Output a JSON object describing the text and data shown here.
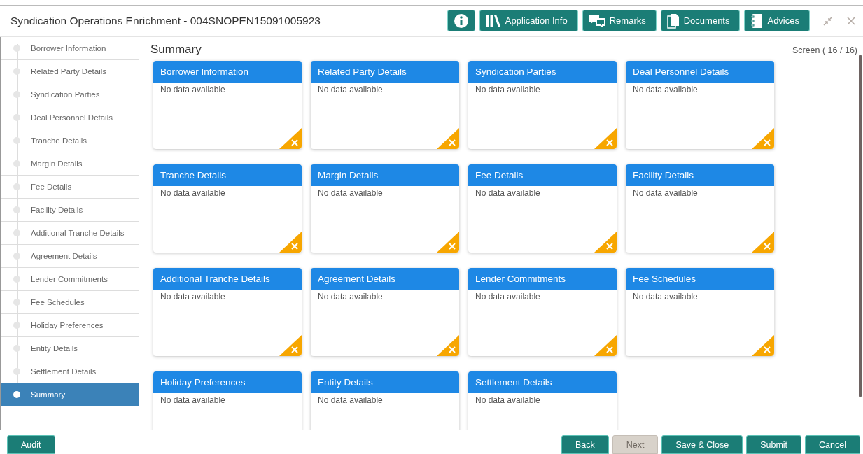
{
  "window": {
    "title": "Syndication Operations Enrichment - 004SNOPEN15091005923"
  },
  "header_buttons": [
    {
      "kind": "info"
    },
    {
      "kind": "books",
      "label": "Application Info"
    },
    {
      "kind": "chat",
      "label": "Remarks"
    },
    {
      "kind": "docs",
      "label": "Documents"
    },
    {
      "kind": "notebook",
      "label": "Advices"
    }
  ],
  "sidebar": {
    "items": [
      {
        "label": "Borrower Information",
        "selected": false
      },
      {
        "label": "Related Party Details",
        "selected": false
      },
      {
        "label": "Syndication Parties",
        "selected": false
      },
      {
        "label": "Deal Personnel Details",
        "selected": false
      },
      {
        "label": "Tranche Details",
        "selected": false
      },
      {
        "label": "Margin Details",
        "selected": false
      },
      {
        "label": "Fee Details",
        "selected": false
      },
      {
        "label": "Facility Details",
        "selected": false
      },
      {
        "label": "Additional Tranche Details",
        "selected": false
      },
      {
        "label": "Agreement Details",
        "selected": false
      },
      {
        "label": "Lender Commitments",
        "selected": false
      },
      {
        "label": "Fee Schedules",
        "selected": false
      },
      {
        "label": "Holiday Preferences",
        "selected": false
      },
      {
        "label": "Entity Details",
        "selected": false
      },
      {
        "label": "Settlement Details",
        "selected": false
      },
      {
        "label": "Summary",
        "selected": true
      }
    ]
  },
  "main": {
    "title": "Summary",
    "screen_counter": "Screen ( 16 / 16)",
    "cards": [
      {
        "title": "Borrower Information",
        "body": "No data available"
      },
      {
        "title": "Related Party Details",
        "body": "No data available"
      },
      {
        "title": "Syndication Parties",
        "body": "No data available"
      },
      {
        "title": "Deal Personnel Details",
        "body": "No data available"
      },
      {
        "title": "Tranche Details",
        "body": "No data available"
      },
      {
        "title": "Margin Details",
        "body": "No data available"
      },
      {
        "title": "Fee Details",
        "body": "No data available"
      },
      {
        "title": "Facility Details",
        "body": "No data available"
      },
      {
        "title": "Additional Tranche Details",
        "body": "No data available"
      },
      {
        "title": "Agreement Details",
        "body": "No data available"
      },
      {
        "title": "Lender Commitments",
        "body": "No data available"
      },
      {
        "title": "Fee Schedules",
        "body": "No data available"
      },
      {
        "title": "Holiday Preferences",
        "body": "No data available"
      },
      {
        "title": "Entity Details",
        "body": "No data available"
      },
      {
        "title": "Settlement Details",
        "body": "No data available"
      }
    ]
  },
  "footer": {
    "left_buttons": [
      {
        "label": "Audit",
        "disabled": false
      }
    ],
    "right_buttons": [
      {
        "label": "Back",
        "disabled": false
      },
      {
        "label": "Next",
        "disabled": true
      },
      {
        "label": "Save & Close",
        "disabled": false
      },
      {
        "label": "Submit",
        "disabled": false
      },
      {
        "label": "Cancel",
        "disabled": false
      }
    ]
  }
}
